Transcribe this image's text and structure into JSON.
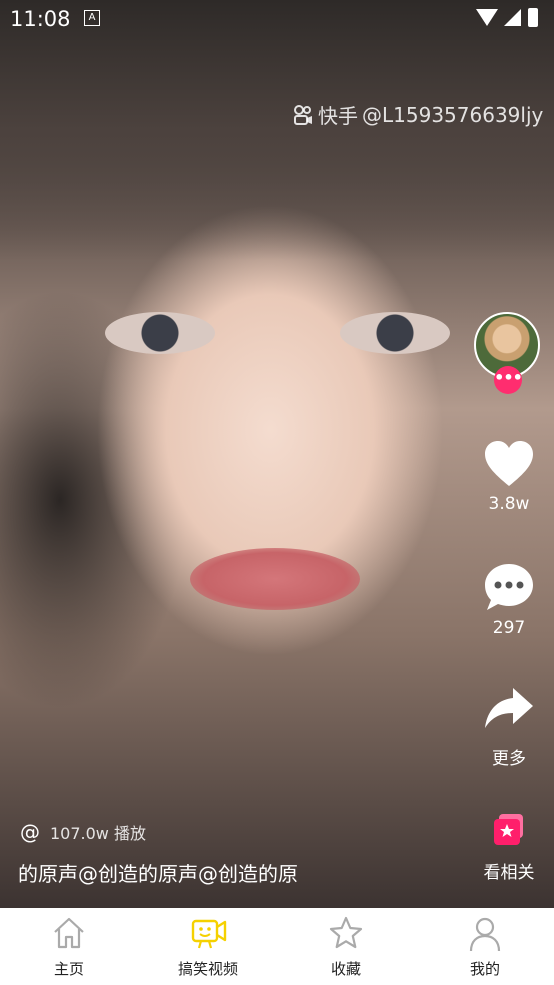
{
  "status_bar": {
    "time": "11:08",
    "notification_badge": "A"
  },
  "watermark": {
    "brand": "快手",
    "handle": "@L1593576639ljy"
  },
  "rail": {
    "like_count": "3.8w",
    "comment_count": "297",
    "share_label": "更多",
    "related_label": "看相关"
  },
  "caption": {
    "username": "@",
    "plays": "107.0w 播放",
    "text": "的原声@创造的原声@创造的原"
  },
  "tabbar": {
    "tabs": [
      {
        "label": "主页",
        "icon": "home-icon"
      },
      {
        "label": "搞笑视频",
        "icon": "video-icon",
        "active": true
      },
      {
        "label": "收藏",
        "icon": "star-icon"
      },
      {
        "label": "我的",
        "icon": "user-icon"
      }
    ],
    "active_color": "#f5d100"
  }
}
